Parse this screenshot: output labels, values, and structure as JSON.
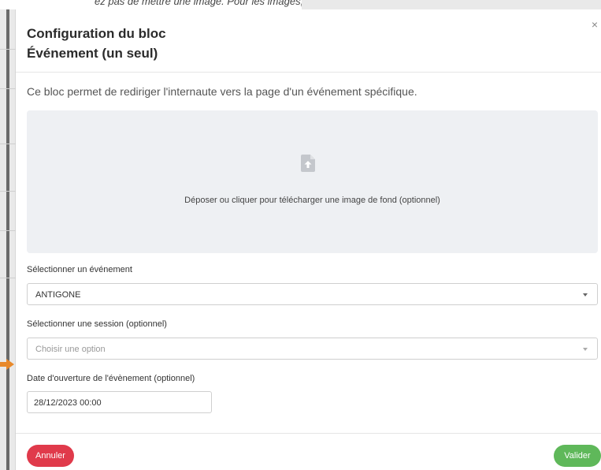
{
  "background": {
    "top_text": "ez pas de mettre une image. Pour les images, voir l'image imag"
  },
  "modal": {
    "title_line1": "Configuration du bloc",
    "title_line2": "Événement (un seul)",
    "close_glyph": "×",
    "intro": "Ce bloc permet de rediriger l'internaute vers la page d'un événement spécifique.",
    "dropzone": {
      "icon": "file-upload-icon",
      "text": "Déposer ou cliquer pour télécharger une image de fond (optionnel)"
    },
    "event_field": {
      "label": "Sélectionner un événement",
      "value": "ANTIGONE"
    },
    "session_field": {
      "label": "Sélectionner une session (optionnel)",
      "placeholder": "Choisir une option"
    },
    "date_field": {
      "label": "Date d'ouverture de l'évènement (optionnel)",
      "value": "28/12/2023 00:00"
    },
    "footer": {
      "cancel_label": "Annuler",
      "submit_label": "Valider"
    }
  },
  "colors": {
    "cancel": "#e03a4b",
    "submit": "#5fb85a",
    "dropzone_bg": "#eef0f3",
    "annotation_arrow": "#e8892b"
  }
}
